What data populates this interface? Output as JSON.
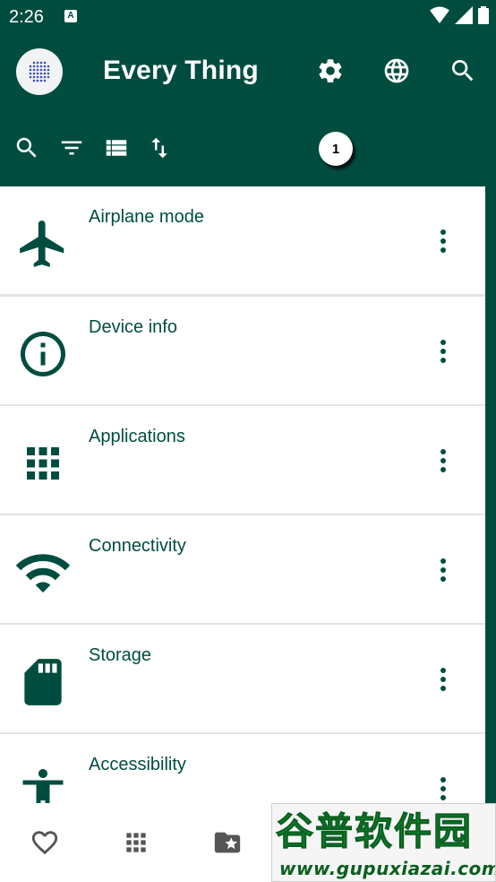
{
  "status_bar": {
    "time": "2:26",
    "notification_badge": "A",
    "icons": [
      "wifi-icon",
      "signal-icon",
      "battery-icon"
    ]
  },
  "app_bar": {
    "title": "Every Thing",
    "actions": [
      "settings-icon",
      "globe-icon",
      "search-icon"
    ]
  },
  "toolbar": {
    "icons": [
      "search-icon",
      "filter-icon",
      "list-view-icon",
      "sort-icon"
    ],
    "badge_count": "1"
  },
  "list": {
    "items": [
      {
        "label": "Airplane mode",
        "icon": "airplane-icon"
      },
      {
        "label": "Device info",
        "icon": "info-icon"
      },
      {
        "label": "Applications",
        "icon": "apps-grid-icon"
      },
      {
        "label": "Connectivity",
        "icon": "wifi-icon"
      },
      {
        "label": "Storage",
        "icon": "sd-card-icon"
      },
      {
        "label": "Accessibility",
        "icon": "accessibility-icon"
      }
    ]
  },
  "bottom_nav": {
    "items": [
      "favorites-icon",
      "apps-grid-icon",
      "starred-folder-icon"
    ]
  },
  "watermark": {
    "main": "谷普软件园",
    "sub": "www.gupuxiazai.com"
  },
  "colors": {
    "primary": "#004d40",
    "surface": "#ffffff",
    "icon_gray": "#555555"
  }
}
